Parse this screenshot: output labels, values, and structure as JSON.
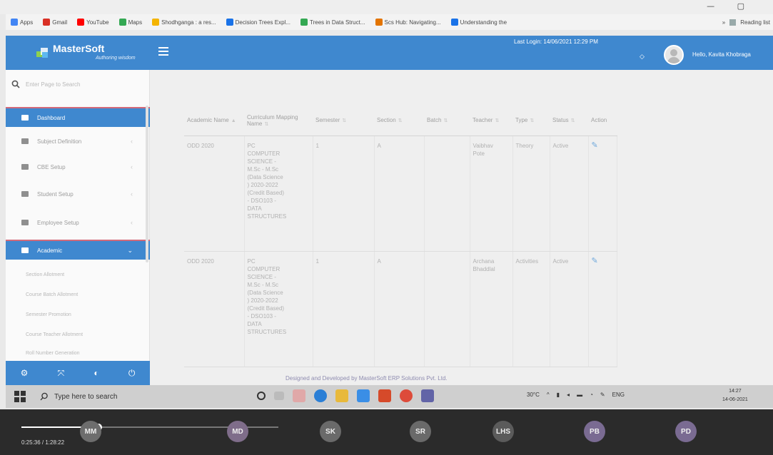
{
  "browser": {
    "bookmarks": [
      {
        "label": "Apps",
        "icon": "apps-grid-icon",
        "color": "#4285f4"
      },
      {
        "label": "Gmail",
        "icon": "gmail-icon",
        "color": "#d93025"
      },
      {
        "label": "YouTube",
        "icon": "youtube-icon",
        "color": "#ff0000"
      },
      {
        "label": "Maps",
        "icon": "maps-icon",
        "color": "#34a853"
      },
      {
        "label": "Shodhganga : a res...",
        "icon": "shodhganga-icon",
        "color": "#f4b400"
      },
      {
        "label": "Decision Trees Expl...",
        "icon": "page-icon",
        "color": "#1a73e8"
      },
      {
        "label": "Trees in Data Struct...",
        "icon": "tree-icon",
        "color": "#34a853"
      },
      {
        "label": "Scs Hub: Navigating...",
        "icon": "hub-icon",
        "color": "#e37400"
      },
      {
        "label": "Understanding the",
        "icon": "page-icon",
        "color": "#1a73e8"
      }
    ],
    "reading_list": "Reading list"
  },
  "header": {
    "brand_name": "MasterSoft",
    "brand_tagline": "Authoring wisdom",
    "last_login": "Last Login: 14/06/2021 12:29 PM",
    "greeting": "Hello, Kavita Khobraga"
  },
  "sidebar": {
    "search_placeholder": "Enter Page to Search",
    "items": [
      {
        "label": "Dashboard",
        "active": true,
        "has_chevron": false
      },
      {
        "label": "Subject Definition",
        "active": false,
        "has_chevron": true
      },
      {
        "label": "CBE Setup",
        "active": false,
        "has_chevron": true
      },
      {
        "label": "Student Setup",
        "active": false,
        "has_chevron": true
      },
      {
        "label": "Employee Setup",
        "active": false,
        "has_chevron": true
      },
      {
        "label": "Academic",
        "active": true,
        "has_chevron": true
      }
    ],
    "sub_items": [
      "Section Allotment",
      "Course Batch Allotment",
      "Semester Promotion",
      "Course Teacher Allotment",
      "Roll Number Generation"
    ]
  },
  "table": {
    "headers": [
      "Academic Name",
      "Curriculum Mapping Name",
      "Semester",
      "Section",
      "Batch",
      "Teacher",
      "Type",
      "Status",
      "Action"
    ],
    "rows": [
      {
        "academic_name": "ODD 2020",
        "curriculum": [
          "PC",
          "COMPUTER",
          "SCIENCE -",
          "M.Sc - M.Sc",
          "(Data Science",
          ") 2020-2022",
          "(Credit Based)",
          "- DSO103 -",
          "DATA",
          "STRUCTURES"
        ],
        "semester": "1",
        "section": "A",
        "batch": "",
        "teacher": [
          "Vaibhav",
          "Pote"
        ],
        "type": "Theory",
        "status": "Active"
      },
      {
        "academic_name": "ODD 2020",
        "curriculum": [
          "PC",
          "COMPUTER",
          "SCIENCE -",
          "M.Sc - M.Sc",
          "(Data Science",
          ") 2020-2022",
          "(Credit Based)",
          "- DSO103 -",
          "DATA",
          "STRUCTURES"
        ],
        "semester": "1",
        "section": "A",
        "batch": "",
        "teacher": [
          "Archana",
          "Bhaddlal"
        ],
        "type": "Activities",
        "status": "Active"
      }
    ]
  },
  "footer_credit": "Designed and Developed by MasterSoft ERP Solutions Pvt. Ltd.",
  "taskbar": {
    "search_placeholder": "Type here to search",
    "temperature": "30°C",
    "language": "ENG",
    "time": "14:27",
    "date": "14-06-2021"
  },
  "call": {
    "timestamp": "0:25:36 / 1:28:22",
    "progress": 0.3,
    "participants": [
      {
        "initials": "MM",
        "color": "#6d6d6d"
      },
      {
        "initials": "MD",
        "color": "#7f6d8a"
      },
      {
        "initials": "SK",
        "color": "#6a6a6a"
      },
      {
        "initials": "SR",
        "color": "#6a6a6a"
      },
      {
        "initials": "LHS",
        "color": "#5b5b5b"
      },
      {
        "initials": "PB",
        "color": "#7a6b92"
      },
      {
        "initials": "PD",
        "color": "#7a6b92"
      }
    ]
  }
}
